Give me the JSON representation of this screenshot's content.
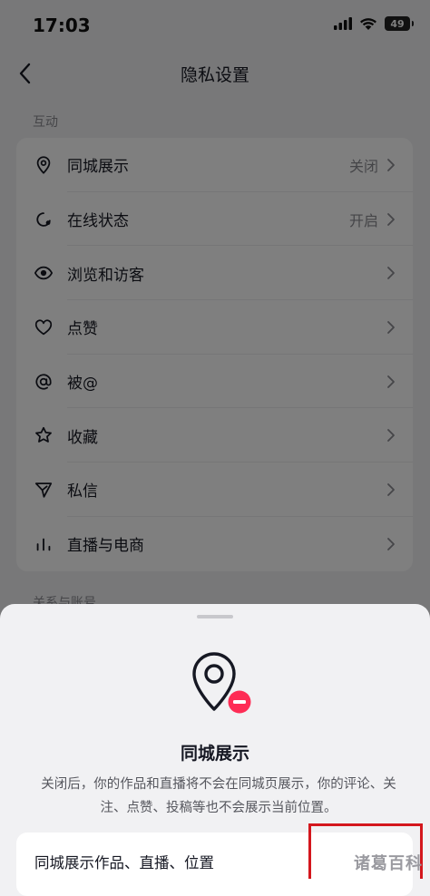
{
  "status_bar": {
    "time": "17:03",
    "battery": "49"
  },
  "nav": {
    "title": "隐私设置"
  },
  "sections": [
    {
      "label": "互动",
      "items": [
        {
          "icon": "location-pin-icon",
          "label": "同城展示",
          "value": "关闭"
        },
        {
          "icon": "online-status-icon",
          "label": "在线状态",
          "value": "开启"
        },
        {
          "icon": "eye-icon",
          "label": "浏览和访客",
          "value": ""
        },
        {
          "icon": "heart-icon",
          "label": "点赞",
          "value": ""
        },
        {
          "icon": "at-icon",
          "label": "被@",
          "value": ""
        },
        {
          "icon": "star-icon",
          "label": "收藏",
          "value": ""
        },
        {
          "icon": "send-icon",
          "label": "私信",
          "value": ""
        },
        {
          "icon": "live-bars-icon",
          "label": "直播与电商",
          "value": ""
        }
      ]
    },
    {
      "label": "关系与账号"
    }
  ],
  "sheet": {
    "icon": "location-off-icon",
    "title": "同城展示",
    "description": "关闭后，你的作品和直播将不会在同城页展示，你的评论、关注、点赞、投稿等也不会展示当前位置。",
    "option_label": "同城展示作品、直播、位置"
  },
  "watermark": "诸葛百科",
  "colors": {
    "accent_red": "#fe2c55",
    "highlight_red": "#d4171d"
  }
}
